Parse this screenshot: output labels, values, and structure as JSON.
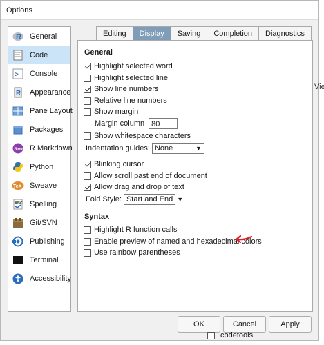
{
  "window": {
    "title": "Options"
  },
  "sidebar": {
    "items": [
      {
        "label": "General",
        "icon": "r-logo-icon"
      },
      {
        "label": "Code",
        "icon": "code-icon"
      },
      {
        "label": "Console",
        "icon": "console-icon"
      },
      {
        "label": "Appearance",
        "icon": "appearance-icon"
      },
      {
        "label": "Pane Layout",
        "icon": "pane-layout-icon"
      },
      {
        "label": "Packages",
        "icon": "packages-icon"
      },
      {
        "label": "R Markdown",
        "icon": "rmarkdown-icon"
      },
      {
        "label": "Python",
        "icon": "python-icon"
      },
      {
        "label": "Sweave",
        "icon": "sweave-icon"
      },
      {
        "label": "Spelling",
        "icon": "spelling-icon"
      },
      {
        "label": "Git/SVN",
        "icon": "git-icon"
      },
      {
        "label": "Publishing",
        "icon": "publishing-icon"
      },
      {
        "label": "Terminal",
        "icon": "terminal-icon"
      },
      {
        "label": "Accessibility",
        "icon": "accessibility-icon"
      }
    ],
    "active_index": 1
  },
  "tabs": [
    "Editing",
    "Display",
    "Saving",
    "Completion",
    "Diagnostics"
  ],
  "active_tab": "Display",
  "general": {
    "title": "General",
    "highlight_selected_word": "Highlight selected word",
    "highlight_selected_line": "Highlight selected line",
    "show_line_numbers": "Show line numbers",
    "relative_line_numbers": "Relative line numbers",
    "show_margin": "Show margin",
    "margin_column_label": "Margin column",
    "margin_column_value": "80",
    "show_whitespace": "Show whitespace characters",
    "indentation_guides_label": "Indentation guides:",
    "indentation_guides_value": "None",
    "blinking_cursor": "Blinking cursor",
    "allow_scroll_past_end": "Allow scroll past end of document",
    "allow_drag_drop": "Allow drag and drop of text",
    "fold_style_label": "Fold Style:",
    "fold_style_value": "Start and End"
  },
  "syntax": {
    "title": "Syntax",
    "highlight_r_function_calls": "Highlight R function calls",
    "enable_preview_colors": "Enable preview of named and hexadecimal colors",
    "rainbow_parentheses": "Use rainbow parentheses"
  },
  "checked": {
    "highlight_selected_word": true,
    "highlight_selected_line": false,
    "show_line_numbers": true,
    "relative_line_numbers": false,
    "show_margin": false,
    "show_whitespace": false,
    "blinking_cursor": true,
    "allow_scroll_past_end": false,
    "allow_drag_drop": true,
    "highlight_r_function_calls": false,
    "enable_preview_colors": false,
    "rainbow_parentheses": false
  },
  "buttons": {
    "ok": "OK",
    "cancel": "Cancel",
    "apply": "Apply"
  },
  "background": {
    "view_text": "Viev",
    "package_row": "codetools"
  },
  "colors": {
    "active_tab_bg": "#7f9db9",
    "sidebar_active_bg": "#cce4f7",
    "annotation_arrow": "#e02020"
  }
}
